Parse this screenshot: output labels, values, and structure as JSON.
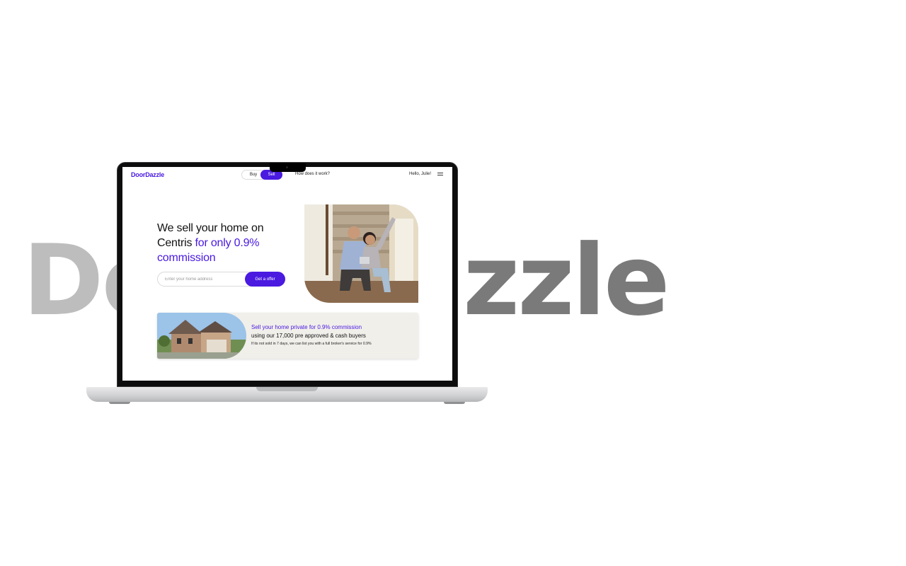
{
  "background": {
    "wordmark_left": "Do",
    "wordmark_right": "zzle"
  },
  "nav": {
    "logo": "DoorDazzle",
    "toggle": {
      "buy": "Buy",
      "sell": "Sell"
    },
    "how_link": "How does it work?",
    "greeting": "Hello, Julie!"
  },
  "hero": {
    "headline_plain": "We sell your home on Centris ",
    "headline_accent": "for only 0.9% commission",
    "search_placeholder": "Enter your home address",
    "cta": "Get a  offer"
  },
  "promo": {
    "title": "Sell your home private for 0.9% commission",
    "subtitle": "using our 17,000 pre approved & cash buyers",
    "note": "If its not sold in 7 days, we can list you with a full broker's service for 0.9%"
  },
  "colors": {
    "accent": "#4a1ae0",
    "card_bg": "#f1efea"
  }
}
